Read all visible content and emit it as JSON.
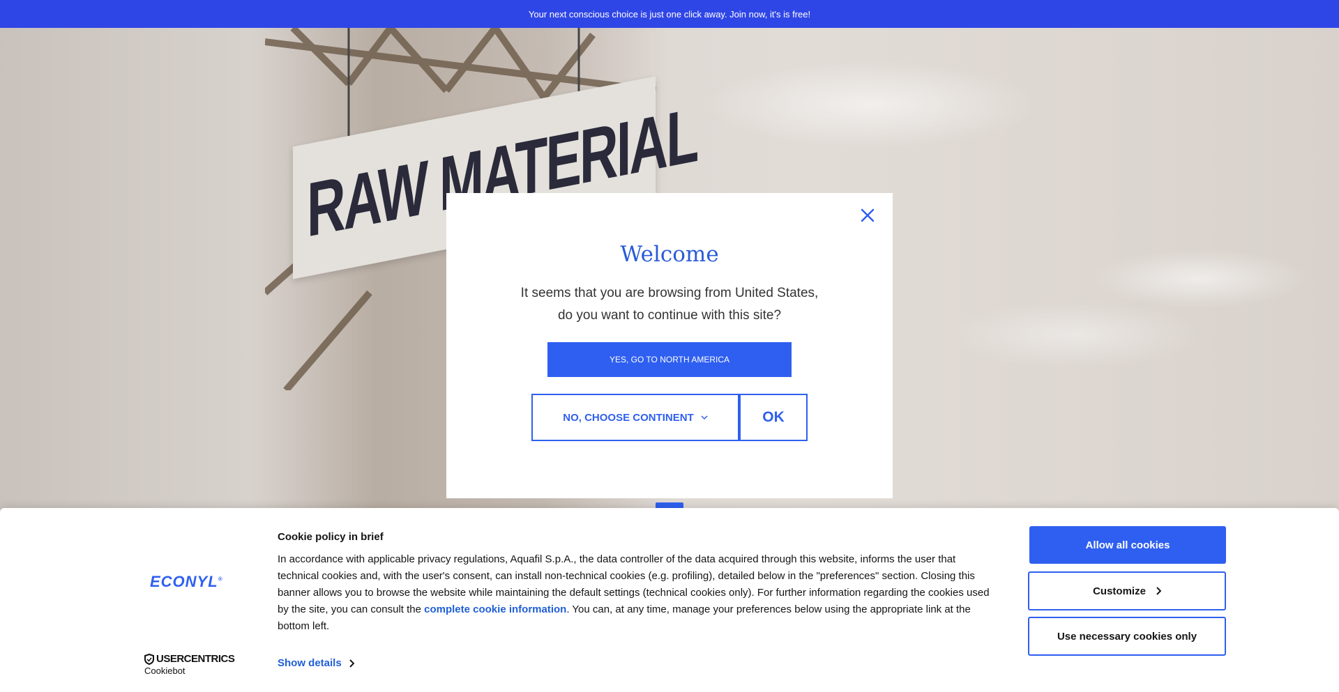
{
  "announcement": {
    "text": "Your next conscious choice is just one click away. Join now, it's is free!"
  },
  "hero": {
    "sign_text": "RAW MATERIAL"
  },
  "welcome_modal": {
    "title": "Welcome",
    "message_line1": "It seems that you are browsing from United States,",
    "message_line2": "do you want to continue with this site?",
    "yes_button": "YES, GO TO NORTH AMERICA",
    "choose_button": "NO, CHOOSE CONTINENT",
    "ok_button": "OK",
    "close_icon": "close-icon"
  },
  "cookie_banner": {
    "brand_logo": "ECONYL",
    "provider_logo_top": "USERCENTRICS",
    "provider_logo_bottom": "Cookiebot",
    "title": "Cookie policy in brief",
    "text_before_link": "In accordance with applicable privacy regulations, Aquafil S.p.A., the data controller of the data acquired through this website, informs the user that technical cookies and, with the user's consent, can install non-technical cookies (e.g. profiling), detailed below in the \"preferences\" section. Closing this banner allows you to browse the website while maintaining the default settings (technical cookies only). For further information regarding the cookies used by the site, you can consult the ",
    "link_text": "complete cookie information",
    "text_after_link": ". You can, at any time, manage your preferences below using the appropriate link at the bottom left.",
    "show_details": "Show details",
    "allow_all": "Allow all cookies",
    "customize": "Customize",
    "necessary_only": "Use necessary cookies only"
  },
  "colors": {
    "accent": "#2f5ff0",
    "announcement_bg": "#2f46e6",
    "text": "#141414"
  }
}
